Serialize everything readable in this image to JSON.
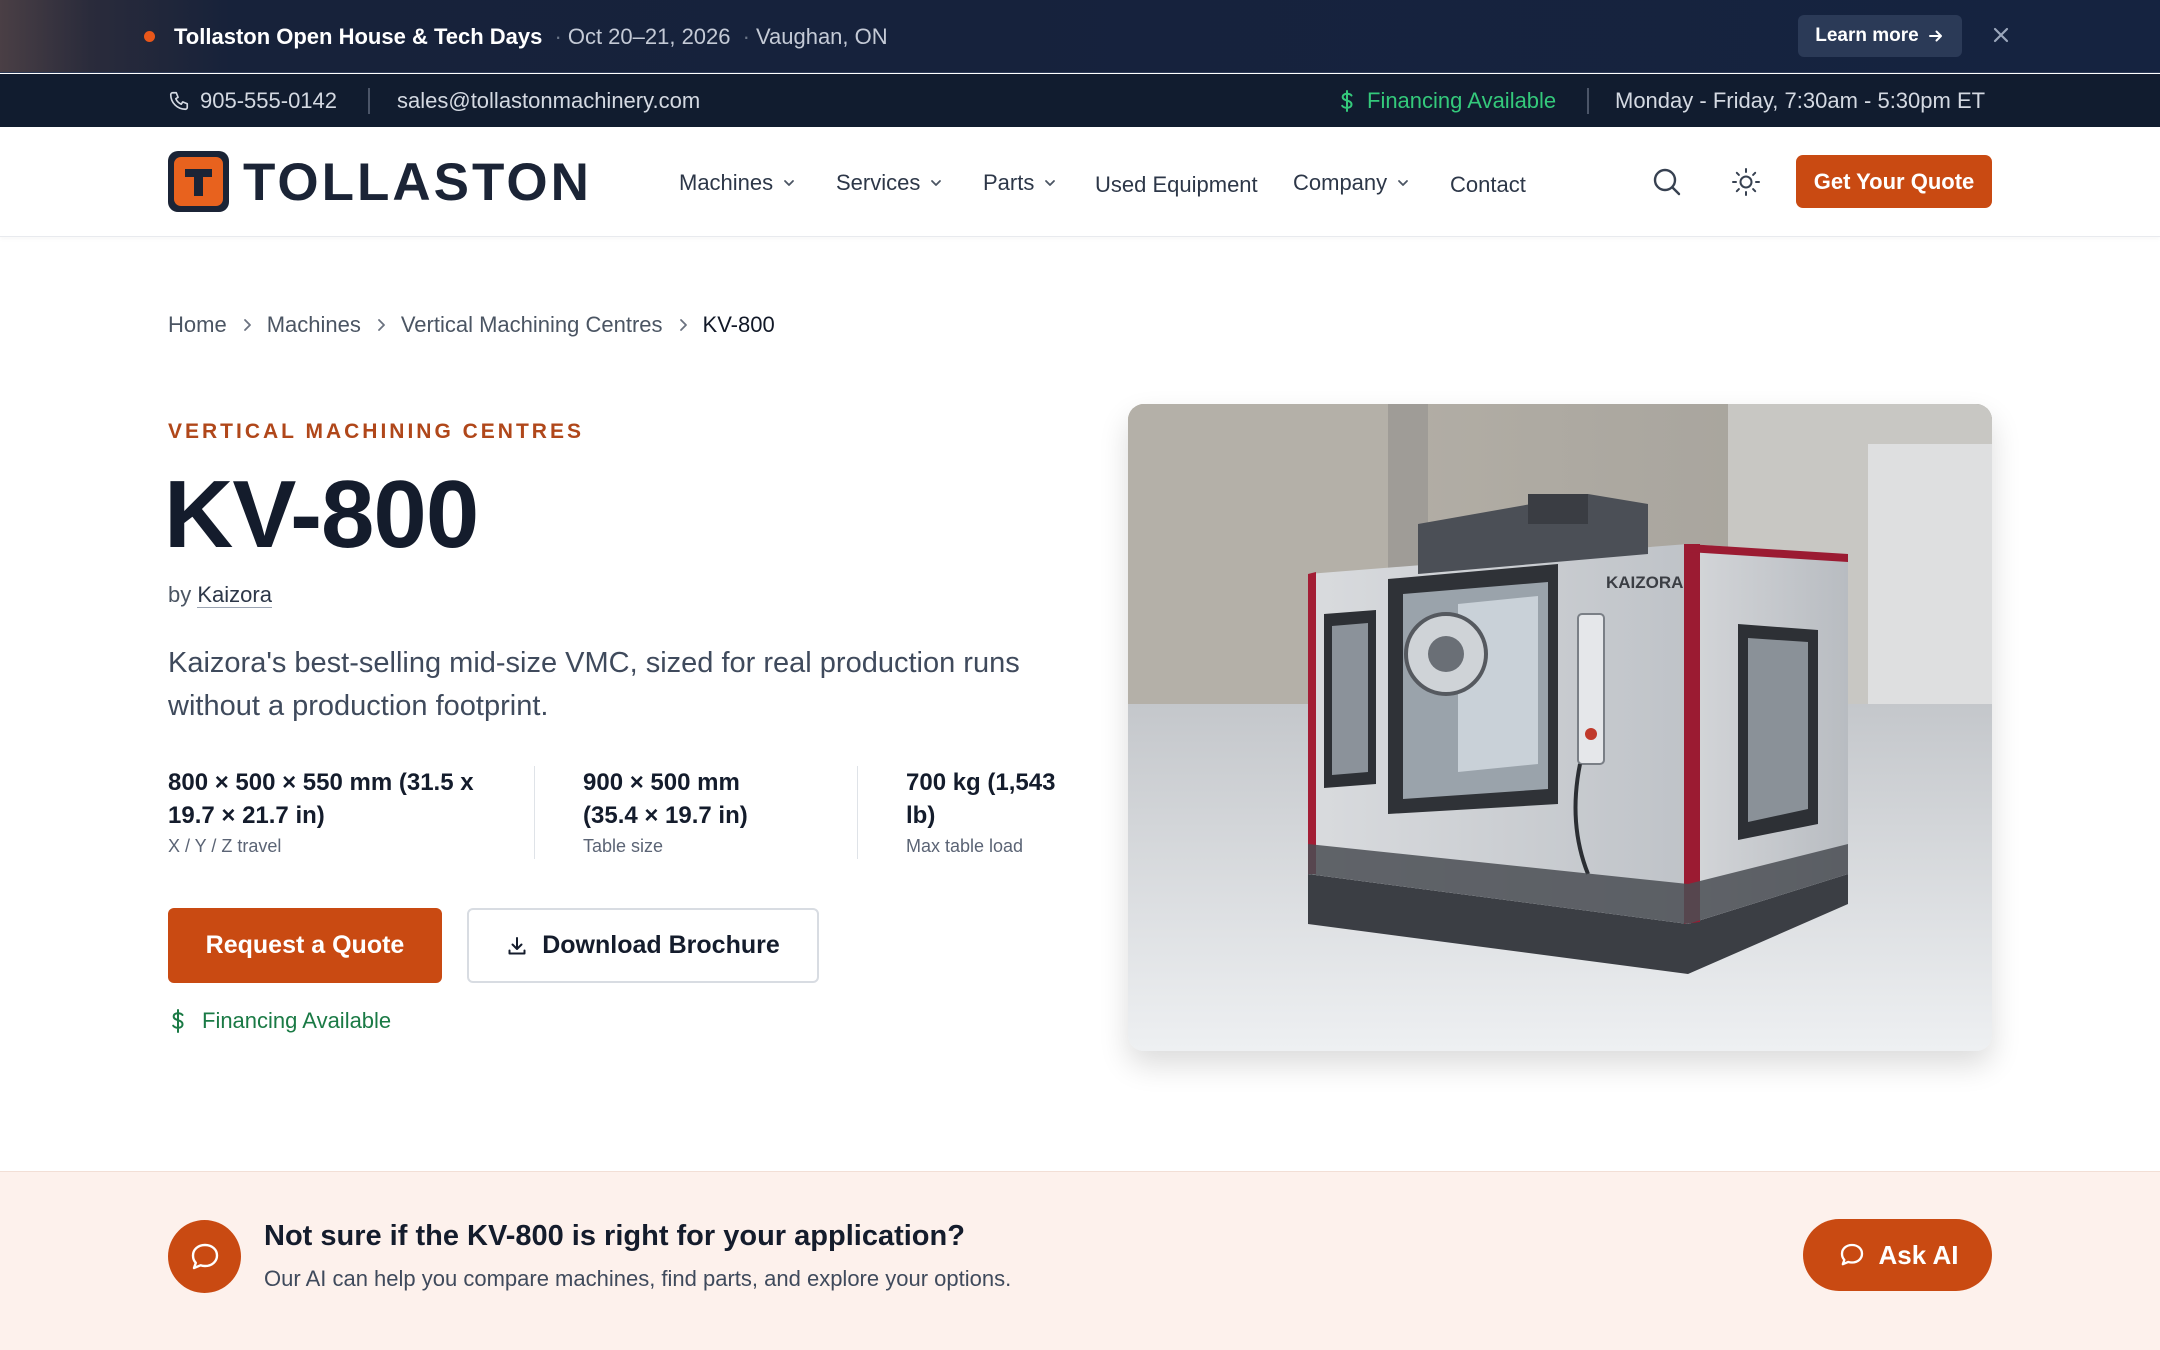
{
  "announcement": {
    "title": "Tollaston Open House & Tech Days",
    "dates": "Oct 20–21, 2026",
    "location": "Vaughan, ON",
    "separator": "·",
    "learn_more": "Learn more",
    "dot_color": "#e8571a"
  },
  "contact": {
    "phone": "905-555-0142",
    "email": "sales@tollastonmachinery.com",
    "financing": "Financing Available",
    "hours": "Monday - Friday, 7:30am - 5:30pm ET"
  },
  "header": {
    "logo_text": "TOLLASTON",
    "logo_letter": "T",
    "nav": {
      "machines": "Machines",
      "services": "Services",
      "parts": "Parts",
      "used": "Used Equipment",
      "company": "Company",
      "contact": "Contact"
    },
    "cta": "Get Your Quote",
    "icons": [
      "search-icon",
      "sun-icon"
    ]
  },
  "breadcrumb": {
    "home": "Home",
    "machines": "Machines",
    "category": "Vertical Machining Centres",
    "current": "KV-800"
  },
  "product": {
    "category": "VERTICAL MACHINING CENTRES",
    "name": "KV-800",
    "by": "by",
    "brand": "Kaizora",
    "description": "Kaizora's best-selling mid-size VMC, sized for real production runs without a production footprint.",
    "specs": [
      {
        "value": "800 × 500 × 550 mm (31.5 x 19.7 × 21.7 in)",
        "label": "X / Y / Z travel"
      },
      {
        "value": "900 × 500 mm (35.4 × 19.7 in)",
        "label": "Table size"
      },
      {
        "value": "700 kg (1,543 lb)",
        "label": "Max table load"
      }
    ],
    "request_quote": "Request a Quote",
    "download_brochure": "Download Brochure",
    "financing": "Financing Available",
    "image_brand_label": "KAIZORA"
  },
  "ai_banner": {
    "title": "Not sure if the KV-800 is right for your application?",
    "subtitle": "Our AI can help you compare machines, find parts, and explore your options.",
    "button": "Ask AI"
  },
  "colors": {
    "accent": "#c94a12",
    "navy": "#141c2c",
    "financing_green": "#1a7a45",
    "banner_bg": "#fdf1ec"
  }
}
